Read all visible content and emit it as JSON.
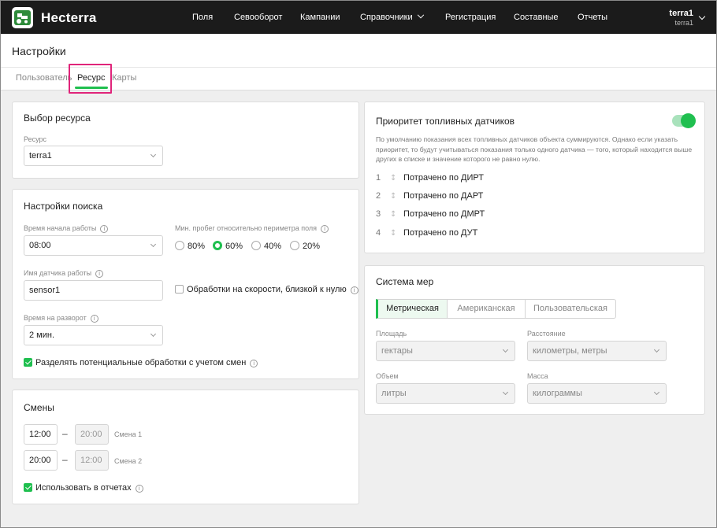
{
  "app": {
    "brand": "Hecterra"
  },
  "nav": {
    "items": [
      "Поля",
      "Севооборот",
      "Кампании",
      "Справочники",
      "Регистрация",
      "Составные",
      "Отчеты"
    ]
  },
  "user": {
    "name": "terra1",
    "org": "terra1"
  },
  "page": {
    "title": "Настройки",
    "tabs": [
      "Пользователь",
      "Ресурс",
      "Карты"
    ],
    "active_tab": "Ресурс"
  },
  "resource": {
    "title": "Выбор ресурса",
    "label": "Ресурс",
    "value": "terra1"
  },
  "search": {
    "title": "Настройки поиска",
    "start_time_label": "Время начала работы",
    "start_time_value": "08:00",
    "min_run_label": "Мин. пробег относительно периметра поля",
    "min_run_options": [
      "80%",
      "60%",
      "40%",
      "20%"
    ],
    "min_run_selected": "60%",
    "sensor_label": "Имя датчика работы",
    "sensor_value": "sensor1",
    "low_speed_label": "Обработки на скорости, близкой к нулю",
    "low_speed_checked": false,
    "turn_label": "Время на разворот",
    "turn_value": "2 мин.",
    "split_label": "Разделять потенциальные обработки с учетом смен",
    "split_checked": true
  },
  "shifts": {
    "title": "Смены",
    "rows": [
      {
        "start": "12:00",
        "end": "20:00",
        "name": "Смена 1"
      },
      {
        "start": "20:00",
        "end": "12:00",
        "name": "Смена 2"
      }
    ],
    "use_in_reports_label": "Использовать в отчетах",
    "use_in_reports_checked": true
  },
  "fuel": {
    "title": "Приоритет топливных датчиков",
    "enabled": true,
    "description": "По умолчанию показания всех топливных датчиков объекта суммируются. Однако если указать приоритет, то будут учитываться показания только одного датчика — того, который находится выше других в списке и значение которого не равно нулю.",
    "items": [
      {
        "n": "1",
        "label": "Потрачено по ДИРТ"
      },
      {
        "n": "2",
        "label": "Потрачено по ДАРТ"
      },
      {
        "n": "3",
        "label": "Потрачено по ДМРТ"
      },
      {
        "n": "4",
        "label": "Потрачено по ДУТ"
      }
    ]
  },
  "units": {
    "title": "Система мер",
    "systems": [
      "Метрическая",
      "Американская",
      "Пользовательская"
    ],
    "active_system": "Метрическая",
    "area_label": "Площадь",
    "area_value": "гектары",
    "distance_label": "Расстояние",
    "distance_value": "километры, метры",
    "volume_label": "Объем",
    "volume_value": "литры",
    "mass_label": "Масса",
    "mass_value": "килограммы"
  },
  "colors": {
    "accent": "#1fbf4f",
    "topbar": "#1b1b1b",
    "highlight": "#e0247a"
  }
}
